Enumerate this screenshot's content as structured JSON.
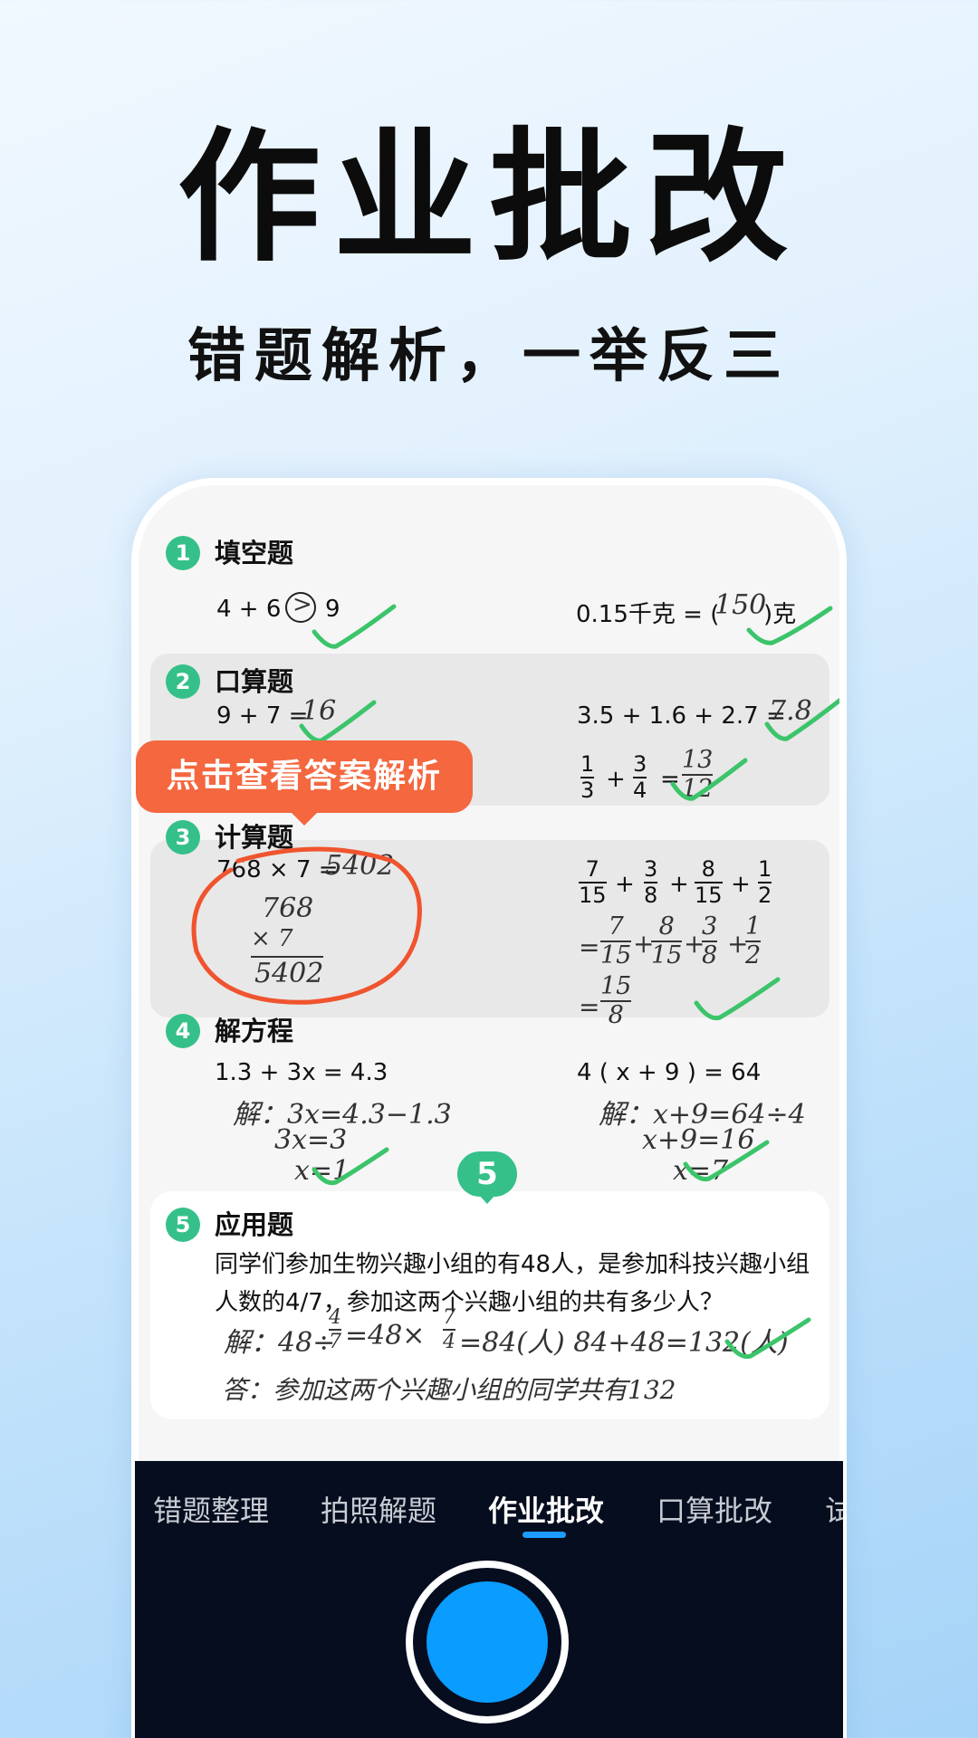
{
  "hero": {
    "title": "作业批改",
    "subtitle": "错题解析，一举反三"
  },
  "sections": {
    "s1": {
      "num": "1",
      "title": "填空题",
      "left": "4 + 6",
      "left_circle": ">",
      "left_after": "9",
      "right_pre": "0.15千克 = (",
      "right_ans": "150",
      "right_post": ")克"
    },
    "s2": {
      "num": "2",
      "title": "口算题",
      "left_eq": "9 + 7 =",
      "left_ans": "16",
      "right_eq": "3.5 + 1.6 + 2.7 =",
      "right_ans": "7.8",
      "frac_a_n": "1",
      "frac_a_d": "3",
      "plus": "+",
      "frac_b_n": "3",
      "frac_b_d": "4",
      "eq": "=",
      "frac_ans_n": "13",
      "frac_ans_d": "12"
    },
    "s3": {
      "num": "3",
      "title": "计算题",
      "left_eq": "768 × 7 =",
      "left_ans": "5402",
      "vert_top": "768",
      "vert_mul": "×   7",
      "vert_res": "5402",
      "r1": {
        "a_n": "7",
        "a_d": "15",
        "b_n": "3",
        "b_d": "8",
        "c_n": "8",
        "c_d": "15",
        "d_n": "1",
        "d_d": "2",
        "plus": "+"
      },
      "r2": {
        "eq": "=",
        "a_n": "7",
        "a_d": "15",
        "b_n": "8",
        "b_d": "15",
        "c_n": "3",
        "c_d": "8",
        "d_n": "1",
        "d_d": "2",
        "plus": "+"
      },
      "r3": {
        "eq": "=",
        "n": "15",
        "d": "8"
      }
    },
    "s4": {
      "num": "4",
      "title": "解方程",
      "left_eq": "1.3 + 3x = 4.3",
      "left_l1": "解：3x=4.3−1.3",
      "left_l2": "3x=3",
      "left_l3": "x=1",
      "right_eq": "4 ( x + 9 ) = 64",
      "right_l1": "解：x+9=64÷4",
      "right_l2": "x+9=16",
      "right_l3": "x=7"
    },
    "s5": {
      "num": "5",
      "title": "应用题",
      "problem": "同学们参加生物兴趣小组的有48人，是参加科技兴趣小组人数的4/7，参加这两个兴趣小组的共有多少人？",
      "sol_pre": "解：48÷",
      "sol_f1_n": "4",
      "sol_f1_d": "7",
      "sol_mid": "=48×",
      "sol_f2_n": "7",
      "sol_f2_d": "4",
      "sol_post": "=84(人)  84+48=132(人)",
      "answer": "答：参加这两个兴趣小组的同学共有132"
    }
  },
  "tooltip": "点击查看答案解析",
  "step_bubble": "5",
  "tabs": [
    {
      "label": "错题整理"
    },
    {
      "label": "拍照解题"
    },
    {
      "label": "作业批改",
      "active": true
    },
    {
      "label": "口算批改"
    },
    {
      "label": "试"
    }
  ],
  "colors": {
    "accent_green": "#35c08a",
    "check_green": "#3cc46b",
    "tooltip_orange": "#f4673f",
    "shutter_blue": "#0a9cff",
    "bar_dark": "#050d1f"
  },
  "icons": {
    "check": "check-mark-icon",
    "circle": "red-circle-annotation",
    "shutter": "shutter-button-icon"
  }
}
